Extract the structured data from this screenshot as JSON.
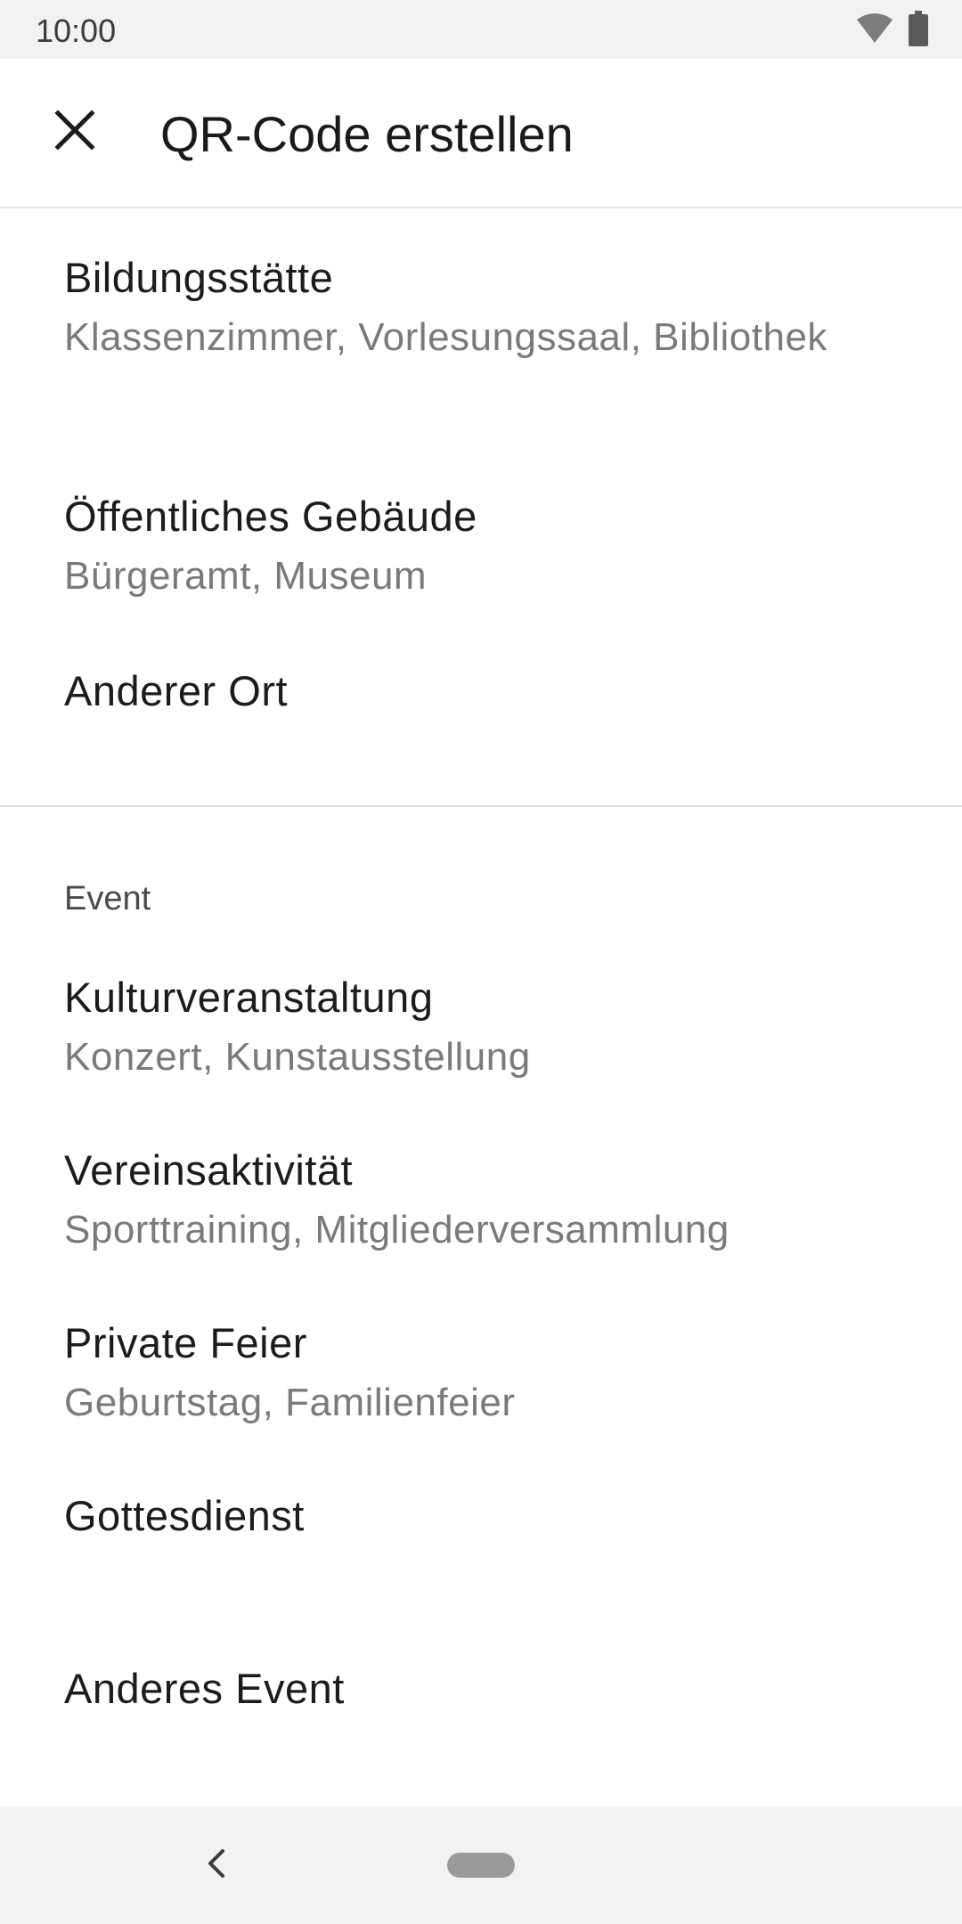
{
  "status_bar": {
    "time": "10:00",
    "icons": [
      "wifi-icon",
      "battery-icon"
    ]
  },
  "app_bar": {
    "close_icon": "close-icon",
    "title": "QR-Code erstellen"
  },
  "places": {
    "items": [
      {
        "title": "Bildungsstätte",
        "subtitle": "Klassenzimmer, Vorlesungssaal, Bibliothek"
      },
      {
        "title": "Öffentliches Gebäude",
        "subtitle": "Bürgeramt, Museum"
      },
      {
        "title": "Anderer Ort",
        "subtitle": ""
      }
    ]
  },
  "events": {
    "label": "Event",
    "items": [
      {
        "title": "Kulturveranstaltung",
        "subtitle": "Konzert, Kunstausstellung"
      },
      {
        "title": "Vereinsaktivität",
        "subtitle": "Sporttraining, Mitgliederversammlung"
      },
      {
        "title": "Private Feier",
        "subtitle": "Geburtstag, Familienfeier"
      },
      {
        "title": "Gottesdienst",
        "subtitle": ""
      },
      {
        "title": "Anderes Event",
        "subtitle": ""
      }
    ]
  },
  "nav_bar": {
    "back_icon": "back-icon",
    "home_icon": "home-pill-icon"
  },
  "colors": {
    "bars": "#f2f2f2",
    "primary_text": "#1c1c1c",
    "secondary_text": "#7a7a7a",
    "divider": "#dcdcdc"
  }
}
